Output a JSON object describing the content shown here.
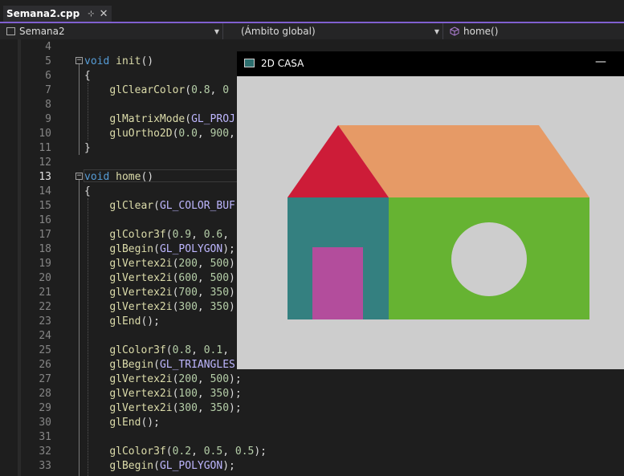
{
  "tab": {
    "title": "Semana2.cpp",
    "pin_icon": "⊹",
    "close_icon": "✕"
  },
  "navbar": {
    "project": "Semana2",
    "scope": "(Ámbito global)",
    "member": "home()"
  },
  "code_lines": [
    {
      "n": "4",
      "t": ""
    },
    {
      "n": "5",
      "t": "void init()"
    },
    {
      "n": "6",
      "t": "{"
    },
    {
      "n": "7",
      "t": "    glClearColor(0.8, 0"
    },
    {
      "n": "8",
      "t": ""
    },
    {
      "n": "9",
      "t": "    glMatrixMode(GL_PROJ"
    },
    {
      "n": "10",
      "t": "    gluOrtho2D(0.0, 900,"
    },
    {
      "n": "11",
      "t": "}"
    },
    {
      "n": "12",
      "t": ""
    },
    {
      "n": "13",
      "t": "void home()"
    },
    {
      "n": "14",
      "t": "{"
    },
    {
      "n": "15",
      "t": "    glClear(GL_COLOR_BUF"
    },
    {
      "n": "16",
      "t": ""
    },
    {
      "n": "17",
      "t": "    glColor3f(0.9, 0.6,"
    },
    {
      "n": "18",
      "t": "    glBegin(GL_POLYGON);"
    },
    {
      "n": "19",
      "t": "    glVertex2i(200, 500)"
    },
    {
      "n": "20",
      "t": "    glVertex2i(600, 500)"
    },
    {
      "n": "21",
      "t": "    glVertex2i(700, 350)"
    },
    {
      "n": "22",
      "t": "    glVertex2i(300, 350)"
    },
    {
      "n": "23",
      "t": "    glEnd();"
    },
    {
      "n": "24",
      "t": ""
    },
    {
      "n": "25",
      "t": "    glColor3f(0.8, 0.1,"
    },
    {
      "n": "26",
      "t": "    glBegin(GL_TRIANGLES"
    },
    {
      "n": "27",
      "t": "    glVertex2i(200, 500);"
    },
    {
      "n": "28",
      "t": "    glVertex2i(100, 350);"
    },
    {
      "n": "29",
      "t": "    glVertex2i(300, 350);"
    },
    {
      "n": "30",
      "t": "    glEnd();"
    },
    {
      "n": "31",
      "t": ""
    },
    {
      "n": "32",
      "t": "    glColor3f(0.2, 0.5, 0.5);"
    },
    {
      "n": "33",
      "t": "    glBegin(GL_POLYGON);"
    }
  ],
  "current_line": "13",
  "window": {
    "title": "2D CASA",
    "minimize_icon": "—"
  },
  "house_colors": {
    "background": "#cdcdcd",
    "roof": "#e69a66",
    "gable": "#cd1c38",
    "teal_wall": "#348080",
    "green_wall": "#66b332",
    "door": "#b34d9c",
    "window_circle": "#cdcdcd"
  }
}
